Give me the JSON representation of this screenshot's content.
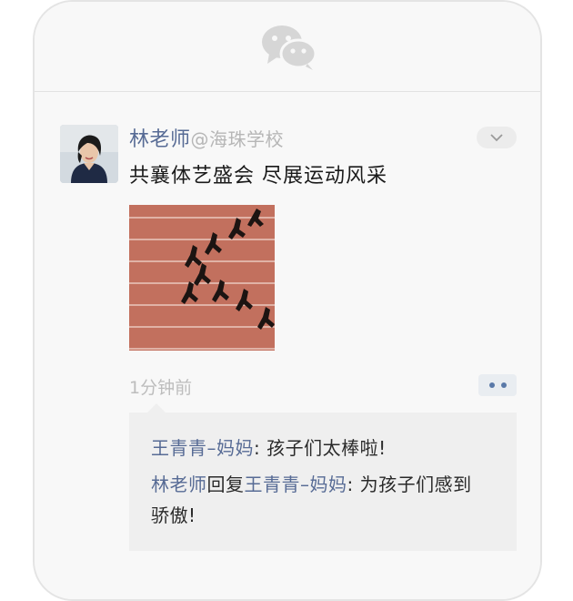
{
  "header": {
    "icon": "wechat-icon"
  },
  "post": {
    "author": "林老师",
    "org": "@海珠学校",
    "text": "共襄体艺盛会 尽展运动风采",
    "time": "1分钟前",
    "image_desc_icon": "track-runners-photo"
  },
  "comments": [
    {
      "author": "王青青–妈妈",
      "separator": ": ",
      "text": "孩子们太棒啦!"
    },
    {
      "author": "林老师",
      "reply_word": "回复",
      "reply_to": "王青青–妈妈",
      "separator": ": ",
      "text": "为孩子们感到骄傲!"
    }
  ],
  "colors": {
    "link": "#576b95",
    "track": "#c2705e",
    "comment_bg": "#efefef"
  }
}
